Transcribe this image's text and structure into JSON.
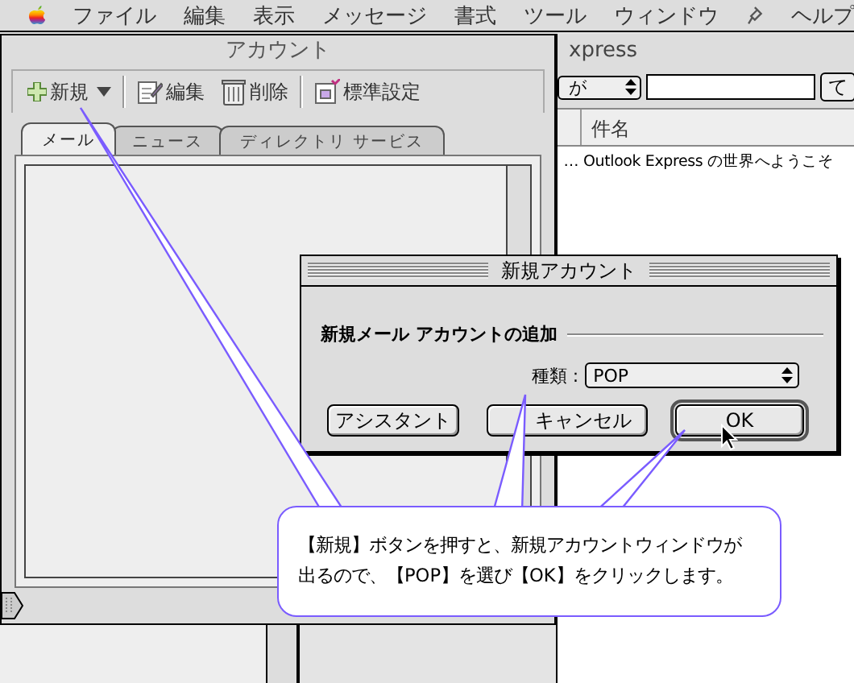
{
  "menu_bar": {
    "items": [
      "ファイル",
      "編集",
      "表示",
      "メッセージ",
      "書式",
      "ツール",
      "ウィンドウ"
    ],
    "help": "ヘルプ"
  },
  "background_window": {
    "title": "xpress",
    "filter": {
      "value": "が"
    },
    "button": "て",
    "columns": [
      "件名"
    ],
    "rows": [
      {
        "column_1": "…",
        "subject": "Outlook Express の世界へようこそ"
      }
    ]
  },
  "account_window": {
    "title": "アカウント",
    "toolbar": [
      {
        "label": "新規",
        "kind": "add"
      },
      {
        "label": "編集",
        "kind": "edit"
      },
      {
        "label": "削除",
        "kind": "delete"
      },
      {
        "label": "標準設定",
        "kind": "default"
      }
    ],
    "tabs": [
      {
        "label": "メール",
        "selected": true
      },
      {
        "label": "ニュース",
        "selected": false
      },
      {
        "label": "ディレクトリ サービス",
        "selected": false
      }
    ]
  },
  "dialog": {
    "title": "新規アカウント",
    "group_label": "新規メール アカウントの追加",
    "field": {
      "label": "種類 :",
      "value": "POP"
    },
    "buttons": [
      {
        "label": "アシスタント",
        "default": false
      },
      {
        "label": "キャンセル",
        "default": false
      },
      {
        "label": "OK",
        "default": true
      }
    ]
  },
  "callout": {
    "lines": [
      "【新規】ボタンを押すと、新規アカウントウィンドウが",
      "出るので、【POP】を選び【OK】をクリックします。"
    ]
  }
}
